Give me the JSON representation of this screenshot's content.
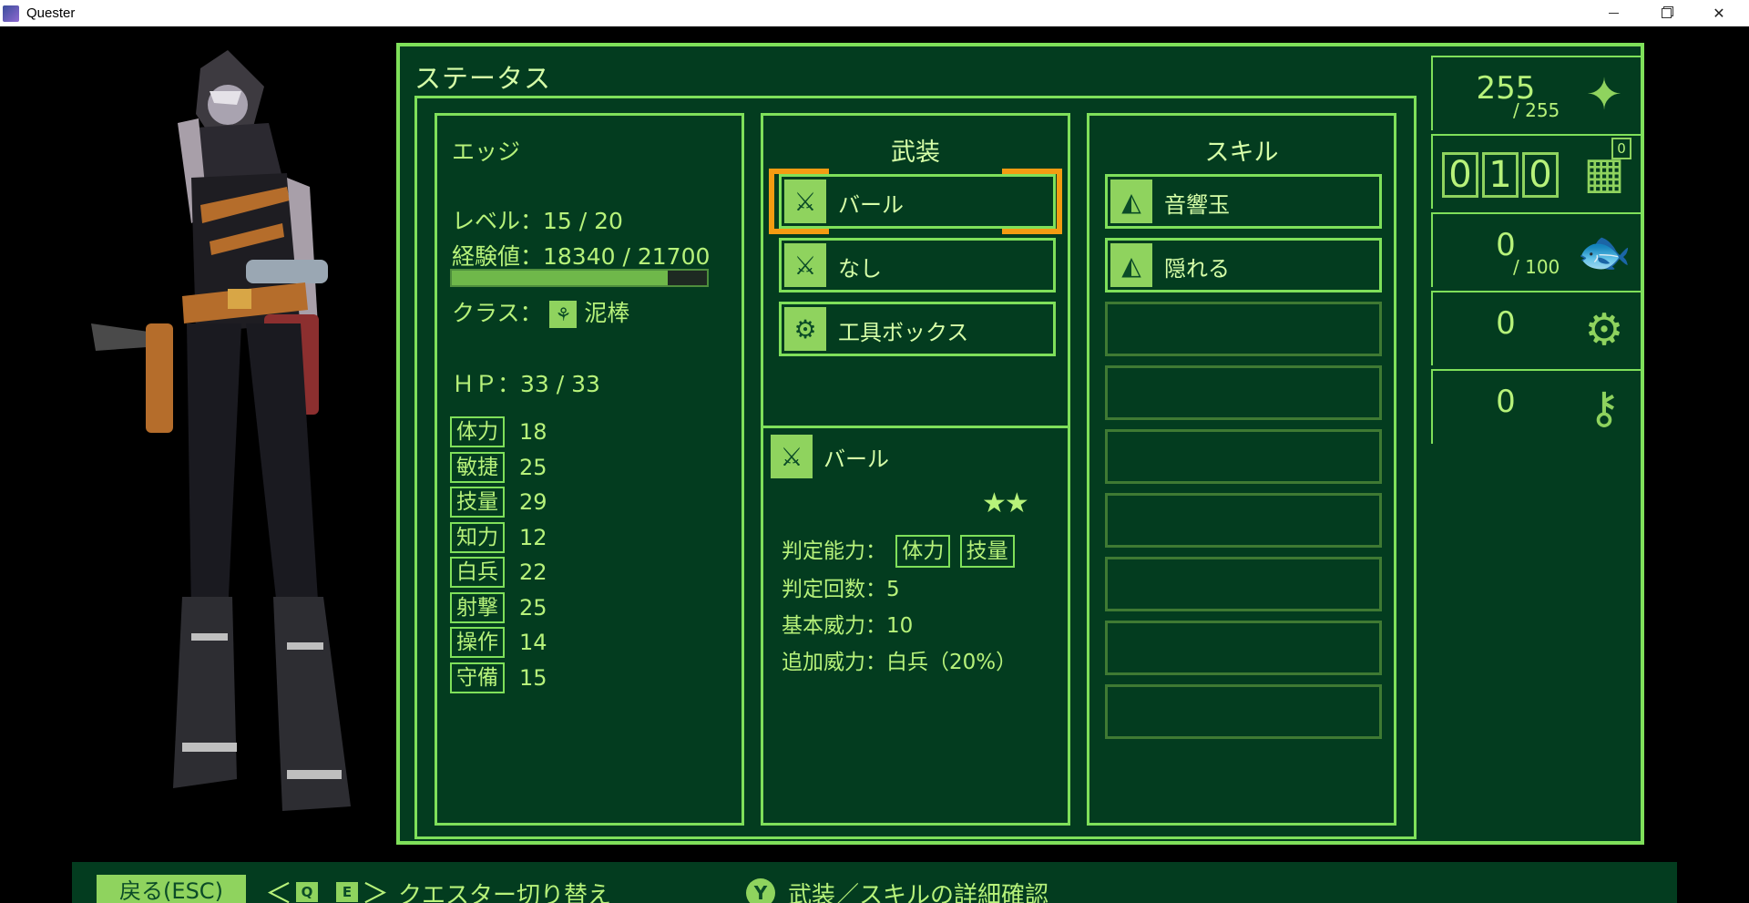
{
  "window": {
    "title": "Quester"
  },
  "status": {
    "title": "ステータス",
    "character": {
      "name": "エッジ",
      "level": "レベル：15 / 20",
      "exp": "経験値：18340 / 21700",
      "exp_progress": 0.845,
      "class_label": "クラス：",
      "class_name": "泥棒",
      "hp": "ＨＰ：33 / 33",
      "stats": [
        {
          "label": "体力",
          "value": "18"
        },
        {
          "label": "敏捷",
          "value": "25"
        },
        {
          "label": "技量",
          "value": "29"
        },
        {
          "label": "知力",
          "value": "12"
        },
        {
          "label": "白兵",
          "value": "22"
        },
        {
          "label": "射撃",
          "value": "25"
        },
        {
          "label": "操作",
          "value": "14"
        },
        {
          "label": "守備",
          "value": "15"
        }
      ]
    },
    "equipment": {
      "header": "武装",
      "slots": [
        {
          "label": "バール",
          "icon": "crossed-blades-icon"
        },
        {
          "label": "なし",
          "icon": "crossed-blades-icon"
        },
        {
          "label": "工具ボックス",
          "icon": "toolbox-icon"
        }
      ],
      "detail": {
        "name": "バール",
        "stars": "★★",
        "judge_label": "判定能力：",
        "judge_tags": [
          "体力",
          "技量"
        ],
        "judge_count": "判定回数：5",
        "base_power": "基本威力：10",
        "extra_power": "追加威力：白兵（20%）"
      }
    },
    "skills": {
      "header": "スキル",
      "slots": [
        {
          "label": "音響玉"
        },
        {
          "label": "隠れる"
        },
        {
          "label": ""
        },
        {
          "label": ""
        },
        {
          "label": ""
        },
        {
          "label": ""
        },
        {
          "label": ""
        },
        {
          "label": ""
        },
        {
          "label": ""
        }
      ]
    },
    "counters": {
      "sparkle": {
        "value": "255",
        "max": "/ 255"
      },
      "calendar": {
        "digits": [
          "0",
          "1",
          "0"
        ],
        "badge": "0"
      },
      "food": {
        "value": "0",
        "max": "/ 100"
      },
      "gears": {
        "value": "0"
      },
      "keys": {
        "value": "0"
      }
    }
  },
  "hints": {
    "back": "戻る(ESC)",
    "switch_key_q": "Q",
    "switch_key_e": "E",
    "switch_label": "クエスター切り替え",
    "detail_key": "Y",
    "detail_label": "武装／スキルの詳細確認"
  },
  "colors": {
    "bg": "#000000",
    "panel": "#033c1f",
    "frame": "#7fe05a",
    "text": "#b7f27a",
    "accent": "#f39c12"
  }
}
